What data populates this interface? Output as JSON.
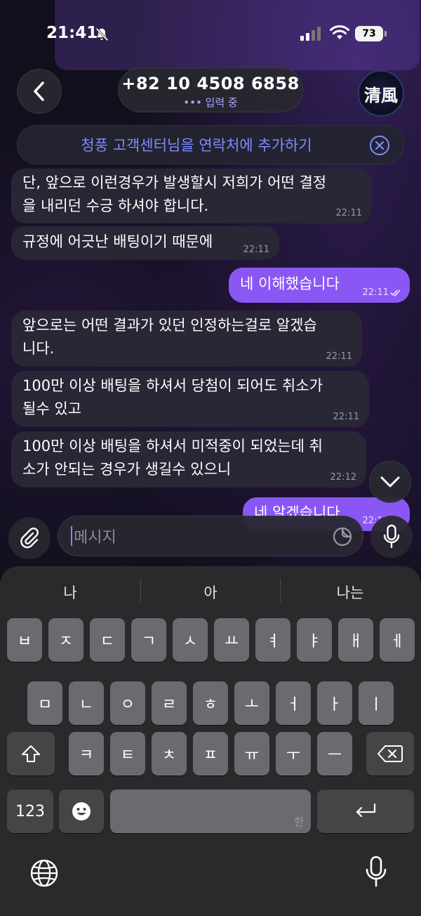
{
  "status": {
    "time": "21:41",
    "battery": "73"
  },
  "header": {
    "title": "+82 10 4508 6858",
    "typing": "••• 입력 중",
    "avatar_text": "清風"
  },
  "banner": {
    "text": "청풍 고객센터님을 연락처에 추가하기"
  },
  "messages": [
    {
      "dir": "in",
      "lines": [
        "단, 앞으로 이런경우가 발생할시 저희가 어떤 결정",
        "을 내리던 수긍 하셔야 합니다."
      ],
      "time": "22:11"
    },
    {
      "dir": "in",
      "lines": [
        "규정에 어긋난 배팅이기 때문에"
      ],
      "time": "22:11"
    },
    {
      "dir": "out",
      "lines": [
        "네 이해했습니다"
      ],
      "time": "22:11"
    },
    {
      "dir": "in",
      "lines": [
        "앞으로는 어떤 결과가 있던 인정하는걸로 알겠습",
        "니다."
      ],
      "time": "22:11"
    },
    {
      "dir": "in",
      "lines": [
        "100만 이상 배팅을 하셔서 당첨이 되어도 취소가",
        "될수 있고"
      ],
      "time": "22:11"
    },
    {
      "dir": "in",
      "lines": [
        "100만 이상 배팅을 하셔서 미적중이 되었는데 취",
        "소가 안되는 경우가 생길수 있으니"
      ],
      "time": "22:12"
    },
    {
      "dir": "out",
      "lines": [
        "네 알겠습니다"
      ],
      "time": "22:12"
    }
  ],
  "input": {
    "placeholder": "메시지"
  },
  "keyboard": {
    "suggestions": [
      "나",
      "아",
      "나는"
    ],
    "row1": [
      "ㅂ",
      "ㅈ",
      "ㄷ",
      "ㄱ",
      "ㅅ",
      "ㅛ",
      "ㅕ",
      "ㅑ",
      "ㅐ",
      "ㅔ"
    ],
    "row2": [
      "ㅁ",
      "ㄴ",
      "ㅇ",
      "ㄹ",
      "ㅎ",
      "ㅗ",
      "ㅓ",
      "ㅏ",
      "ㅣ"
    ],
    "row3": [
      "ㅋ",
      "ㅌ",
      "ㅊ",
      "ㅍ",
      "ㅠ",
      "ㅜ",
      "ㅡ"
    ],
    "numbers_key": "123",
    "space_hint": "한"
  },
  "colors": {
    "accent": "#8a57f5",
    "link": "#7c8cff",
    "bubble_in": "#2a2836"
  },
  "icons": [
    "mute-bell-icon",
    "signal-icon",
    "wifi-icon",
    "back-chevron-icon",
    "close-circle-icon",
    "chevron-down-icon",
    "paperclip-icon",
    "sticker-icon",
    "microphone-icon",
    "shift-icon",
    "backspace-icon",
    "emoji-icon",
    "return-icon",
    "globe-icon"
  ]
}
